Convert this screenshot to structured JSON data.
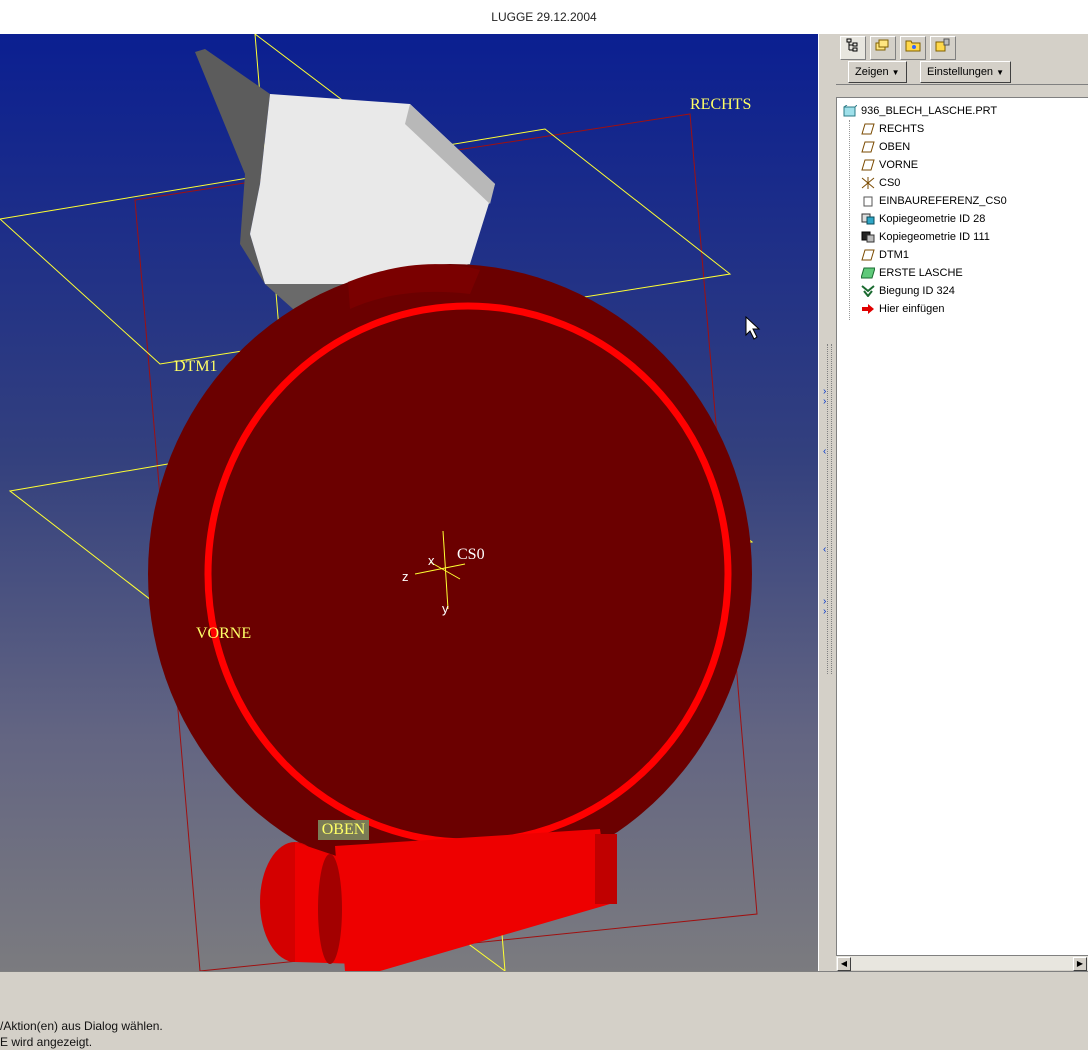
{
  "window": {
    "title": "LUGGE 29.12.2004"
  },
  "viewport": {
    "labels": {
      "rechts": "RECHTS",
      "dtm1": "DTM1",
      "vorne": "VORNE",
      "oben": "OBEN",
      "cs0": "CS0",
      "axis_x": "x",
      "axis_y": "y",
      "axis_z": "z"
    },
    "colors": {
      "datum": "#ffff33",
      "part": "#ee0000",
      "sheet": "#e6e6e6",
      "background_top": "#0b1f91"
    }
  },
  "panel": {
    "tabs": [
      {
        "icon": "model-tree-icon"
      },
      {
        "icon": "layers-icon"
      },
      {
        "icon": "folder-icon"
      },
      {
        "icon": "favorites-icon"
      }
    ],
    "menus": {
      "show_label": "Zeigen",
      "settings_label": "Einstellungen"
    },
    "tree": {
      "root": "936_BLECH_LASCHE.PRT",
      "items": [
        {
          "label": "RECHTS",
          "icon": "datum-plane-icon"
        },
        {
          "label": "OBEN",
          "icon": "datum-plane-icon"
        },
        {
          "label": "VORNE",
          "icon": "datum-plane-icon"
        },
        {
          "label": "CS0",
          "icon": "coordinate-system-icon"
        },
        {
          "label": "EINBAUREFERENZ_CS0",
          "icon": "reference-icon"
        },
        {
          "label": "Kopiegeometrie ID 28",
          "icon": "copy-geometry-icon"
        },
        {
          "label": "Kopiegeometrie ID 111",
          "icon": "copy-geometry-icon"
        },
        {
          "label": "DTM1",
          "icon": "datum-plane-icon"
        },
        {
          "label": "ERSTE LASCHE",
          "icon": "sheetmetal-wall-icon"
        },
        {
          "label": "Biegung ID 324",
          "icon": "bend-icon"
        },
        {
          "label": "Hier einfügen",
          "icon": "insert-here-icon"
        }
      ]
    }
  },
  "status": {
    "lines": [
      "/Aktion(en) aus Dialog wählen.",
      "E wird angezeigt."
    ]
  }
}
